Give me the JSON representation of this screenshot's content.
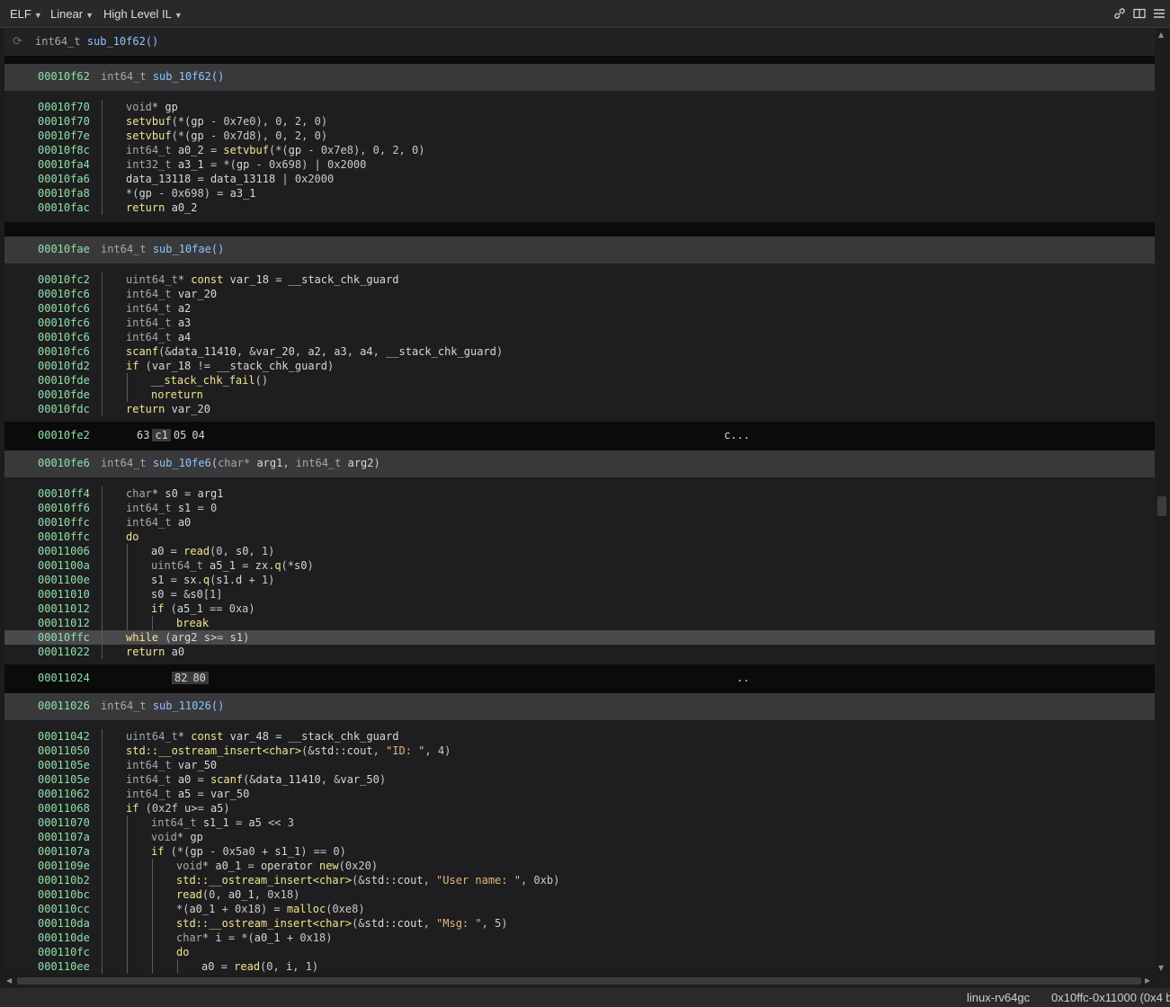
{
  "toolbar": {
    "menu1": "ELF",
    "menu2": "Linear",
    "menu3": "High Level IL",
    "icons": [
      "link-icon",
      "split-view-icon",
      "hamburger-menu-icon"
    ]
  },
  "signature": {
    "type": "int64_t",
    "name": "sub_10f62()"
  },
  "status": {
    "arch": "linux-rv64gc",
    "range": "0x10ffc-0x11000 (0x4 b"
  },
  "functions": [
    {
      "address": "00010f62",
      "ret": "int64_t",
      "name": "sub_10f62",
      "params": "()",
      "lines": [
        {
          "addr": "00010f70",
          "indent": 0,
          "text": "void* gp"
        },
        {
          "addr": "00010f70",
          "indent": 0,
          "text": "setvbuf(*(gp - 0x7e0), 0, 2, 0)"
        },
        {
          "addr": "00010f7e",
          "indent": 0,
          "text": "setvbuf(*(gp - 0x7d8), 0, 2, 0)"
        },
        {
          "addr": "00010f8c",
          "indent": 0,
          "text": "int64_t a0_2 = setvbuf(*(gp - 0x7e8), 0, 2, 0)"
        },
        {
          "addr": "00010fa4",
          "indent": 0,
          "text": "int32_t a3_1 = *(gp - 0x698) | 0x2000"
        },
        {
          "addr": "00010fa6",
          "indent": 0,
          "text": "data_13118 = data_13118 | 0x2000"
        },
        {
          "addr": "00010fa8",
          "indent": 0,
          "text": "*(gp - 0x698) = a3_1"
        },
        {
          "addr": "00010fac",
          "indent": 0,
          "text": "return a0_2"
        }
      ]
    },
    {
      "address": "00010fae",
      "ret": "int64_t",
      "name": "sub_10fae",
      "params": "()",
      "lines": [
        {
          "addr": "00010fc2",
          "indent": 0,
          "text": "uint64_t* const var_18 = __stack_chk_guard"
        },
        {
          "addr": "00010fc6",
          "indent": 0,
          "text": "int64_t var_20"
        },
        {
          "addr": "00010fc6",
          "indent": 0,
          "text": "int64_t a2"
        },
        {
          "addr": "00010fc6",
          "indent": 0,
          "text": "int64_t a3"
        },
        {
          "addr": "00010fc6",
          "indent": 0,
          "text": "int64_t a4"
        },
        {
          "addr": "00010fc6",
          "indent": 0,
          "text": "scanf(&data_11410, &var_20, a2, a3, a4, __stack_chk_guard)"
        },
        {
          "addr": "00010fd2",
          "indent": 0,
          "text": "if (var_18 != __stack_chk_guard)"
        },
        {
          "addr": "00010fde",
          "indent": 1,
          "text": "__stack_chk_fail()"
        },
        {
          "addr": "00010fde",
          "indent": 1,
          "text": "noreturn"
        },
        {
          "addr": "00010fdc",
          "indent": 0,
          "text": "return var_20"
        }
      ]
    },
    {
      "address": "00010fe6",
      "ret": "int64_t",
      "name": "sub_10fe6",
      "params_parts": [
        "char*",
        "arg1",
        "int64_t",
        "arg2"
      ],
      "lines": [
        {
          "addr": "00010ff4",
          "indent": 0,
          "text": "char* s0 = arg1"
        },
        {
          "addr": "00010ff6",
          "indent": 0,
          "text": "int64_t s1 = 0"
        },
        {
          "addr": "00010ffc",
          "indent": 0,
          "text": "int64_t a0"
        },
        {
          "addr": "00010ffc",
          "indent": 0,
          "text": "do"
        },
        {
          "addr": "00011006",
          "indent": 1,
          "text": "a0 = read(0, s0, 1)"
        },
        {
          "addr": "0001100a",
          "indent": 1,
          "text": "uint64_t a5_1 = zx.q(*s0)"
        },
        {
          "addr": "0001100e",
          "indent": 1,
          "text": "s1 = sx.q(s1.d + 1)"
        },
        {
          "addr": "00011010",
          "indent": 1,
          "text": "s0 = &s0[1]"
        },
        {
          "addr": "00011012",
          "indent": 1,
          "text": "if (a5_1 == 0xa)"
        },
        {
          "addr": "00011012",
          "indent": 2,
          "text": "break"
        },
        {
          "addr": "00010ffc",
          "indent": 0,
          "text": "while (arg2 s>= s1)",
          "highlight": true
        },
        {
          "addr": "00011022",
          "indent": 0,
          "text": "return a0"
        }
      ]
    },
    {
      "address": "00011026",
      "ret": "int64_t",
      "name": "sub_11026",
      "params": "()",
      "lines": [
        {
          "addr": "00011042",
          "indent": 0,
          "text": "uint64_t* const var_48 = __stack_chk_guard"
        },
        {
          "addr": "00011050",
          "indent": 0,
          "text": "std::__ostream_insert<char>(&std::cout, \"ID: \", 4)"
        },
        {
          "addr": "0001105e",
          "indent": 0,
          "text": "int64_t var_50"
        },
        {
          "addr": "0001105e",
          "indent": 0,
          "text": "int64_t a0 = scanf(&data_11410, &var_50)"
        },
        {
          "addr": "00011062",
          "indent": 0,
          "text": "int64_t a5 = var_50"
        },
        {
          "addr": "00011068",
          "indent": 0,
          "text": "if (0x2f u>= a5)"
        },
        {
          "addr": "00011070",
          "indent": 1,
          "text": "int64_t s1_1 = a5 << 3"
        },
        {
          "addr": "0001107a",
          "indent": 1,
          "text": "void* gp"
        },
        {
          "addr": "0001107a",
          "indent": 1,
          "text": "if (*(gp - 0x5a0 + s1_1) == 0)"
        },
        {
          "addr": "0001109e",
          "indent": 2,
          "text": "void* a0_1 = operator new(0x20)"
        },
        {
          "addr": "000110b2",
          "indent": 2,
          "text": "std::__ostream_insert<char>(&std::cout, \"User name: \", 0xb)"
        },
        {
          "addr": "000110bc",
          "indent": 2,
          "text": "read(0, a0_1, 0x18)"
        },
        {
          "addr": "000110cc",
          "indent": 2,
          "text": "*(a0_1 + 0x18) = malloc(0xe8)"
        },
        {
          "addr": "000110da",
          "indent": 2,
          "text": "std::__ostream_insert<char>(&std::cout, \"Msg: \", 5)"
        },
        {
          "addr": "000110de",
          "indent": 2,
          "text": "char* i = *(a0_1 + 0x18)"
        },
        {
          "addr": "000110fc",
          "indent": 2,
          "text": "do"
        },
        {
          "addr": "000110ee",
          "indent": 3,
          "text": "a0 = read(0, i, 1)"
        }
      ]
    }
  ],
  "data_rows": [
    {
      "addr": "00010fe2",
      "bytes": [
        "63",
        "c1",
        "05",
        "04"
      ],
      "ascii": "c..."
    },
    {
      "addr": "00011024",
      "bytes": [
        "82",
        "80"
      ],
      "ascii": ".."
    }
  ]
}
